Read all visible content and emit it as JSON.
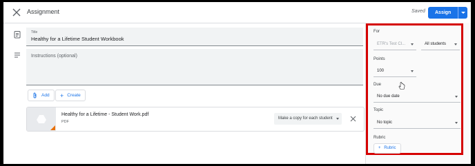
{
  "header": {
    "title": "Assignment",
    "saved": "Saved",
    "assign_label": "Assign"
  },
  "main": {
    "title_label": "Title",
    "title_value": "Healthy for a Lifetime Student Workbook",
    "instructions_placeholder": "Instructions (optional)",
    "add_label": "Add",
    "create_label": "Create",
    "attachment": {
      "name": "Healthy for a Lifetime - Student Work.pdf",
      "type": "PDF",
      "copy_option": "Make a copy for each student"
    }
  },
  "side_panel": {
    "for_label": "For",
    "class_value": "ETR's Test Cl...",
    "students_value": "All students",
    "points_label": "Points",
    "points_value": "100",
    "due_label": "Due",
    "due_value": "No due date",
    "topic_label": "Topic",
    "topic_value": "No topic",
    "rubric_label": "Rubric",
    "rubric_button": "Rubric"
  },
  "colors": {
    "accent": "#1a73e8",
    "highlight": "#d50000",
    "attachment_mark": "#e8710a"
  },
  "icons": [
    "close-icon",
    "assignment-icon",
    "notes-icon",
    "attach-icon",
    "plus-icon",
    "drive-icon",
    "hand-cursor-icon"
  ]
}
